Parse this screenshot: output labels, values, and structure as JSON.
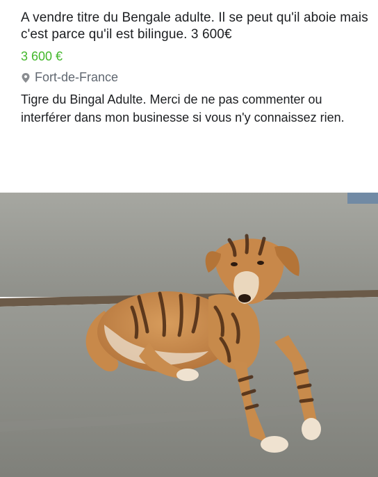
{
  "post": {
    "title": "A vendre titre du Bengale adulte. Il se peut qu'il aboie mais c'est parce qu'il est bilingue. 3 600€",
    "price": "3 600 €",
    "location_icon": "map-pin-icon",
    "location": "Fort-de-France",
    "description": "Tigre du Bingal Adulte. Merci de ne pas commenter ou interférer dans mon businesse si vous n'y connaissez rien."
  },
  "photo": {
    "subject": "dog-painted-with-tiger-stripes-photo",
    "colors": {
      "floor": "#8d8e88",
      "wall": "#9a9b95",
      "fur": "#c68a4d",
      "stripe": "#4a2a14"
    }
  }
}
